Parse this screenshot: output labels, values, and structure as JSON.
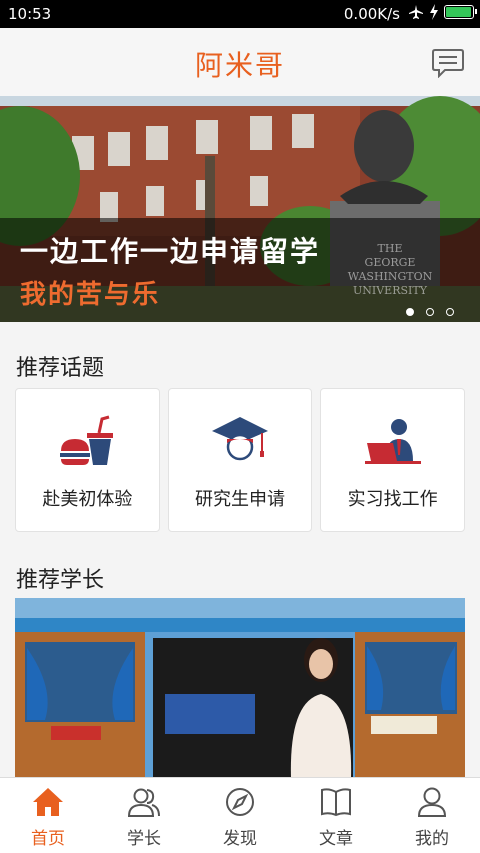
{
  "status_bar": {
    "time": "10:53",
    "network_speed": "0.00K/s",
    "battery_level": 1.0
  },
  "header": {
    "title": "阿米哥",
    "message_icon": "chat-bubble-icon"
  },
  "banner": {
    "headline": "一边工作一边申请留学",
    "subheadline": "我的苦与乐",
    "engraving": [
      "THE",
      "GEORGE",
      "WASHINGTON",
      "UNIVERSITY"
    ],
    "slides": 3,
    "active_slide": 1
  },
  "topics": {
    "title": "推荐话题",
    "items": [
      {
        "label": "赴美初体验",
        "icon": "burger-drink-icon"
      },
      {
        "label": "研究生申请",
        "icon": "graduate-cap-icon"
      },
      {
        "label": "实习找工作",
        "icon": "office-worker-icon"
      }
    ]
  },
  "seniors": {
    "title": "推荐学长"
  },
  "tabbar": {
    "items": [
      {
        "label": "首页",
        "icon": "home-icon",
        "active": true
      },
      {
        "label": "学长",
        "icon": "people-icon",
        "active": false
      },
      {
        "label": "发现",
        "icon": "compass-icon",
        "active": false
      },
      {
        "label": "文章",
        "icon": "book-icon",
        "active": false
      },
      {
        "label": "我的",
        "icon": "person-icon",
        "active": false
      }
    ]
  },
  "colors": {
    "accent": "#e8601f",
    "navy": "#2d4a7a",
    "red": "#c62b33"
  }
}
